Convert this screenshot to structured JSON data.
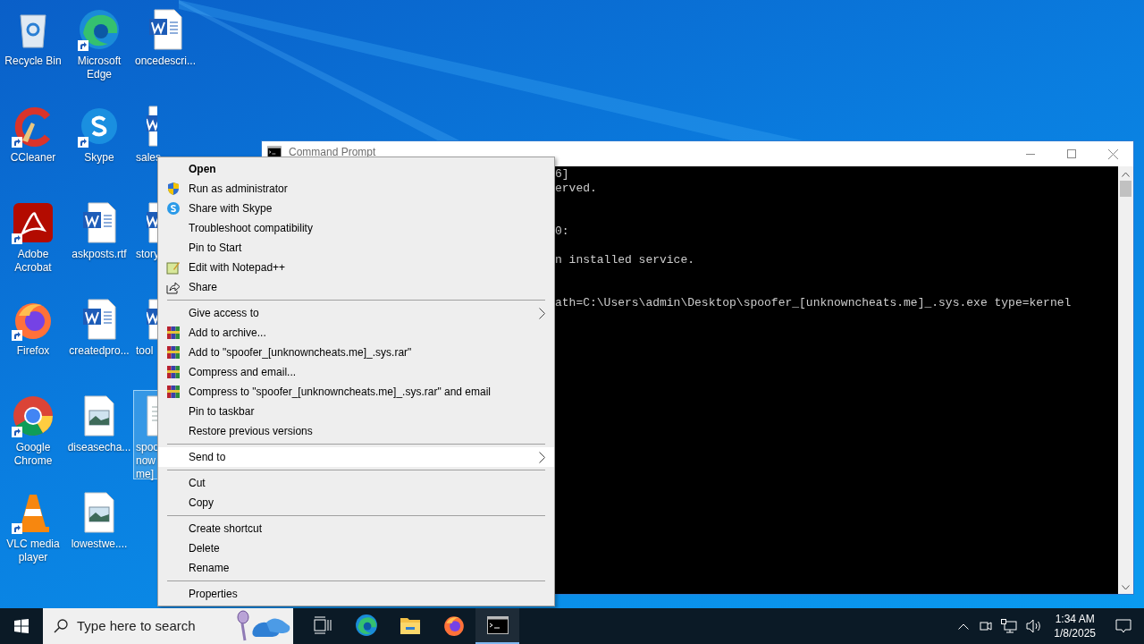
{
  "desktop_icons": [
    {
      "label": [
        "Recycle Bin"
      ],
      "kind": "recycle",
      "shortcut": false,
      "selected": false,
      "clipped": false
    },
    {
      "label": [
        "CCleaner"
      ],
      "kind": "ccleaner",
      "shortcut": true,
      "selected": false,
      "clipped": false
    },
    {
      "label": [
        "Adobe",
        "Acrobat"
      ],
      "kind": "acrobat",
      "shortcut": true,
      "selected": false,
      "clipped": false
    },
    {
      "label": [
        "Firefox"
      ],
      "kind": "firefox",
      "shortcut": true,
      "selected": false,
      "clipped": false
    },
    {
      "label": [
        "Google",
        "Chrome"
      ],
      "kind": "chrome",
      "shortcut": true,
      "selected": false,
      "clipped": false
    },
    {
      "label": [
        "VLC media",
        "player"
      ],
      "kind": "vlc",
      "shortcut": true,
      "selected": false,
      "clipped": false
    },
    {
      "label": [
        "Microsoft",
        "Edge"
      ],
      "kind": "edge",
      "shortcut": true,
      "selected": false,
      "clipped": false
    },
    {
      "label": [
        "Skype"
      ],
      "kind": "skype",
      "shortcut": true,
      "selected": false,
      "clipped": false
    },
    {
      "label": [
        "askposts.rtf"
      ],
      "kind": "word",
      "shortcut": false,
      "selected": false,
      "clipped": false
    },
    {
      "label": [
        "createdpro..."
      ],
      "kind": "word",
      "shortcut": false,
      "selected": false,
      "clipped": false
    },
    {
      "label": [
        "diseasecha..."
      ],
      "kind": "image",
      "shortcut": false,
      "selected": false,
      "clipped": false
    },
    {
      "label": [
        "lowestwe...."
      ],
      "kind": "image",
      "shortcut": false,
      "selected": false,
      "clipped": false
    },
    {
      "label": [
        "oncedescri..."
      ],
      "kind": "word",
      "shortcut": false,
      "selected": false,
      "clipped": false
    },
    {
      "label": [
        "sales"
      ],
      "kind": "word",
      "shortcut": false,
      "selected": false,
      "clipped": true
    },
    {
      "label": [
        "story"
      ],
      "kind": "word",
      "shortcut": false,
      "selected": false,
      "clipped": true
    },
    {
      "label": [
        "tool"
      ],
      "kind": "word",
      "shortcut": false,
      "selected": false,
      "clipped": true
    },
    {
      "label": [
        "spoo",
        "now",
        "me]"
      ],
      "kind": "text",
      "shortcut": false,
      "selected": true,
      "clipped": true
    }
  ],
  "console_window": {
    "title": "Command Prompt",
    "active": false,
    "blocks": [
      [
        "6]",
        "erved."
      ],
      [
        "0:"
      ],
      [
        "n installed service."
      ],
      [
        "ath=C:\\Users\\admin\\Desktop\\spoofer_[unknowncheats.me]_.sys.exe type=kernel"
      ]
    ]
  },
  "context_menu": [
    {
      "kind": "plain",
      "label": "Open",
      "bold": true,
      "submenu": false,
      "selected": false
    },
    {
      "kind": "shield",
      "label": "Run as administrator",
      "bold": false,
      "submenu": false,
      "selected": false
    },
    {
      "kind": "skype",
      "label": "Share with Skype",
      "bold": false,
      "submenu": false,
      "selected": false
    },
    {
      "kind": "plain",
      "label": "Troubleshoot compatibility",
      "bold": false,
      "submenu": false,
      "selected": false
    },
    {
      "kind": "plain",
      "label": "Pin to Start",
      "bold": false,
      "submenu": false,
      "selected": false
    },
    {
      "kind": "notepad",
      "label": "Edit with Notepad++",
      "bold": false,
      "submenu": false,
      "selected": false
    },
    {
      "kind": "share",
      "label": "Share",
      "bold": false,
      "submenu": false,
      "selected": false
    },
    {
      "kind": "separator"
    },
    {
      "kind": "plain",
      "label": "Give access to",
      "bold": false,
      "submenu": true,
      "selected": false
    },
    {
      "kind": "archive",
      "label": "Add to archive...",
      "bold": false,
      "submenu": false,
      "selected": false
    },
    {
      "kind": "archive",
      "label": "Add to \"spoofer_[unknowncheats.me]_.sys.rar\"",
      "bold": false,
      "submenu": false,
      "selected": false
    },
    {
      "kind": "archive",
      "label": "Compress and email...",
      "bold": false,
      "submenu": false,
      "selected": false
    },
    {
      "kind": "archive",
      "label": "Compress to \"spoofer_[unknowncheats.me]_.sys.rar\" and email",
      "bold": false,
      "submenu": false,
      "selected": false
    },
    {
      "kind": "plain",
      "label": "Pin to taskbar",
      "bold": false,
      "submenu": false,
      "selected": false
    },
    {
      "kind": "plain",
      "label": "Restore previous versions",
      "bold": false,
      "submenu": false,
      "selected": false
    },
    {
      "kind": "separator"
    },
    {
      "kind": "plain",
      "label": "Send to",
      "bold": false,
      "submenu": true,
      "selected": true
    },
    {
      "kind": "separator"
    },
    {
      "kind": "plain",
      "label": "Cut",
      "bold": false,
      "submenu": false,
      "selected": false
    },
    {
      "kind": "plain",
      "label": "Copy",
      "bold": false,
      "submenu": false,
      "selected": false
    },
    {
      "kind": "separator"
    },
    {
      "kind": "plain",
      "label": "Create shortcut",
      "bold": false,
      "submenu": false,
      "selected": false
    },
    {
      "kind": "plain",
      "label": "Delete",
      "bold": false,
      "submenu": false,
      "selected": false
    },
    {
      "kind": "plain",
      "label": "Rename",
      "bold": false,
      "submenu": false,
      "selected": false
    },
    {
      "kind": "separator"
    },
    {
      "kind": "plain",
      "label": "Properties",
      "bold": false,
      "submenu": false,
      "selected": false
    }
  ],
  "taskbar": {
    "search": {
      "placeholder": "Type here to search"
    },
    "apps": [
      {
        "kind": "taskview",
        "active": false
      },
      {
        "kind": "edge",
        "active": false
      },
      {
        "kind": "explorer",
        "active": false
      },
      {
        "kind": "firefox",
        "active": false
      },
      {
        "kind": "cmd",
        "active": true
      }
    ],
    "clock": {
      "time": "1:34 AM",
      "date": "1/8/2025"
    }
  }
}
